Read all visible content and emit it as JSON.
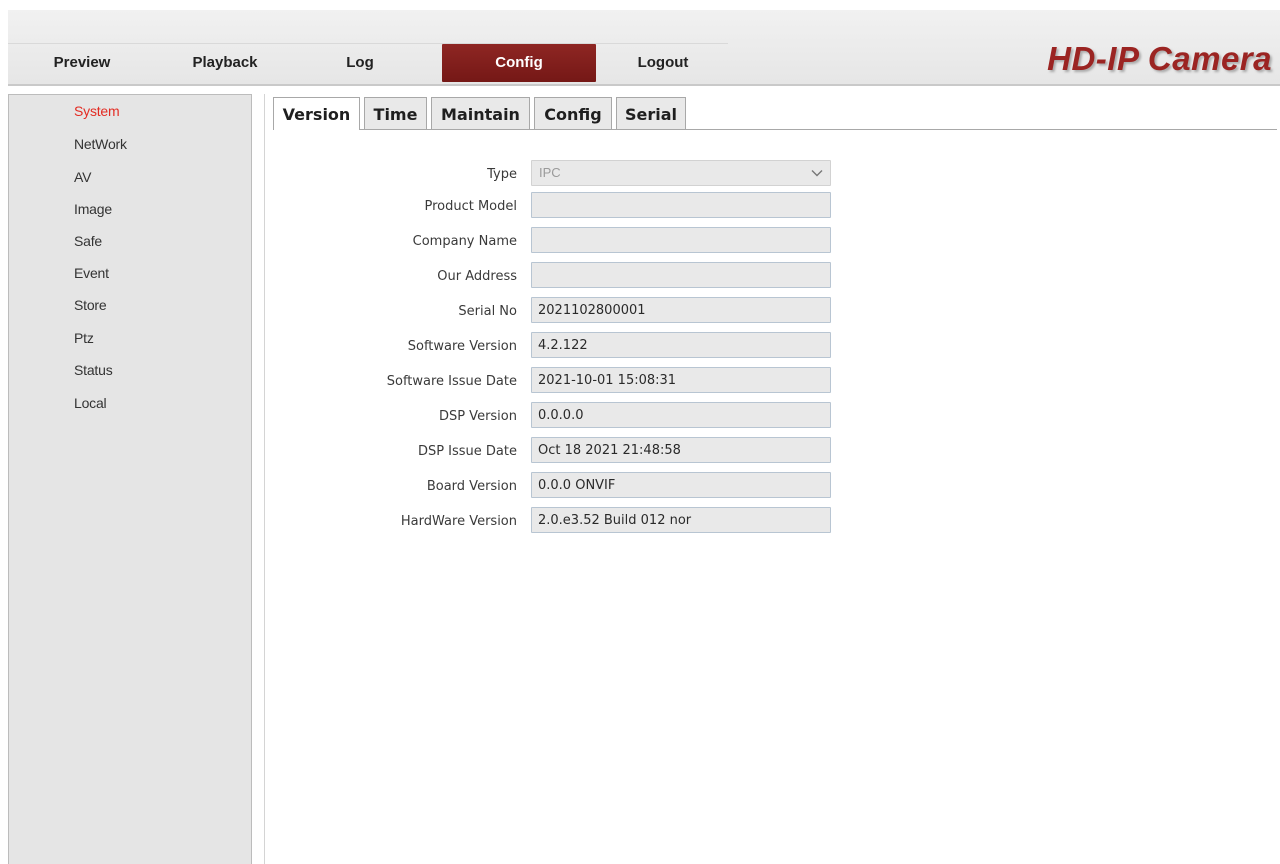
{
  "header": {
    "brand": "HD-IP Camera",
    "nav": [
      {
        "label": "Preview"
      },
      {
        "label": "Playback"
      },
      {
        "label": "Log"
      },
      {
        "label": "Config"
      },
      {
        "label": "Logout"
      }
    ],
    "active_nav": "Config"
  },
  "sidebar": {
    "items": [
      {
        "label": "System"
      },
      {
        "label": "NetWork"
      },
      {
        "label": "AV"
      },
      {
        "label": "Image"
      },
      {
        "label": "Safe"
      },
      {
        "label": "Event"
      },
      {
        "label": "Store"
      },
      {
        "label": "Ptz"
      },
      {
        "label": "Status"
      },
      {
        "label": "Local"
      }
    ],
    "active_item": "System"
  },
  "tabs": [
    {
      "label": "Version"
    },
    {
      "label": "Time"
    },
    {
      "label": "Maintain"
    },
    {
      "label": "Config"
    },
    {
      "label": "Serial"
    }
  ],
  "active_tab": "Version",
  "form": {
    "type": {
      "label": "Type",
      "value": "IPC",
      "icon": "chevron-down-icon"
    },
    "fields": [
      {
        "label": "Product Model",
        "value": ""
      },
      {
        "label": "Company Name",
        "value": ""
      },
      {
        "label": "Our Address",
        "value": ""
      },
      {
        "label": "Serial No",
        "value": "2021102800001"
      },
      {
        "label": "Software Version",
        "value": "4.2.122"
      },
      {
        "label": "Software Issue Date",
        "value": "2021-10-01 15:08:31"
      },
      {
        "label": "DSP Version",
        "value": "0.0.0.0"
      },
      {
        "label": "DSP Issue Date",
        "value": "Oct 18 2021 21:48:58"
      },
      {
        "label": "Board Version",
        "value": "0.0.0 ONVIF"
      },
      {
        "label": "HardWare Version",
        "value": "2.0.e3.52 Build 012 nor"
      }
    ]
  },
  "colors": {
    "accent": "#861f1d",
    "active_sidebar_text": "#e32c23",
    "brand_text": "#9b2422"
  }
}
